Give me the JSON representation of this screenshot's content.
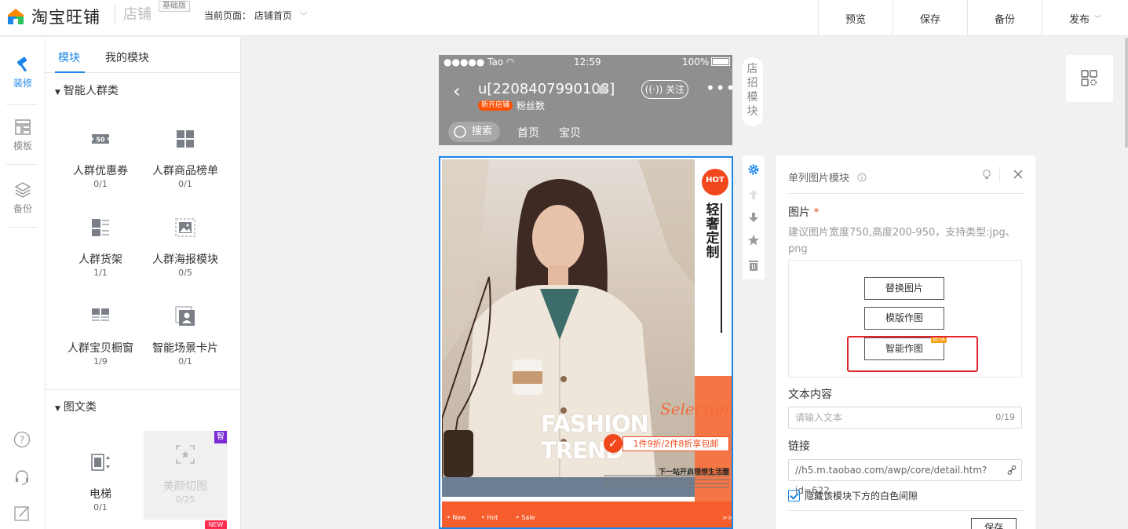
{
  "topbar": {
    "brand": "淘宝旺铺",
    "section": "店铺",
    "badge": "基础版",
    "current_label": "当前页面：",
    "current_value": "店铺首页",
    "actions": [
      "预览",
      "保存",
      "备份",
      "发布"
    ]
  },
  "leftnav": {
    "items": [
      "装修",
      "模板",
      "备份"
    ]
  },
  "modules": {
    "tabs": [
      "模块",
      "我的模块"
    ],
    "sections": [
      {
        "title": "智能人群类",
        "items": [
          {
            "name": "人群优惠券",
            "count": "0/1",
            "icon_text": "50"
          },
          {
            "name": "人群商品榜单",
            "count": "0/1"
          },
          {
            "name": "人群货架",
            "count": "1/1"
          },
          {
            "name": "人群海报模块",
            "count": "0/5"
          },
          {
            "name": "人群宝贝橱窗",
            "count": "1/9"
          },
          {
            "name": "智能场景卡片",
            "count": "0/1"
          }
        ]
      },
      {
        "title": "图文类",
        "items": [
          {
            "name": "电梯",
            "count": "0/1"
          },
          {
            "name": "美颜切图",
            "count": "0/25"
          }
        ]
      }
    ],
    "badges": {
      "smart": "智",
      "new": "NEW"
    }
  },
  "phone": {
    "carrier": "●●●●● Tao",
    "time": "12:59",
    "battery": "100%",
    "shop_name": "u[2208407990108]",
    "new_shop": "新开店铺",
    "fans": "粉丝数",
    "follow": "关注",
    "search": "搜索",
    "nav": [
      "首页",
      "宝贝"
    ]
  },
  "side_tab": "店招模块",
  "banner": {
    "hot": "HOT",
    "vertical_title": "轻奢定制",
    "selection": "Selection",
    "headline": "FASHION TREND",
    "promo": "1件9折/2件8折享包邮",
    "slogan": "下一站开启理想生活圈",
    "bottom_links": [
      "New",
      "Hot",
      "Sale",
      ">>"
    ]
  },
  "panel": {
    "title": "单列图片模块",
    "image_label": "图片",
    "required_mark": "*",
    "hint": "建议图片宽度750,高度200-950，支持类型:jpg、png",
    "buttons": [
      "替换图片",
      "模版作图",
      "智能作图"
    ],
    "beta": "BETA",
    "text_label": "文本内容",
    "text_placeholder": "请输入文本",
    "text_counter": "0/19",
    "link_label": "链接",
    "link_value": "//h5.m.taobao.com/awp/core/detail.htm?id=622",
    "checkbox_label": "隐藏该模块下方的白色间隙",
    "save": "保存"
  },
  "colors": {
    "accent": "#1c86e8",
    "orange": "#f75e2e",
    "highlight": "#e0262c"
  }
}
